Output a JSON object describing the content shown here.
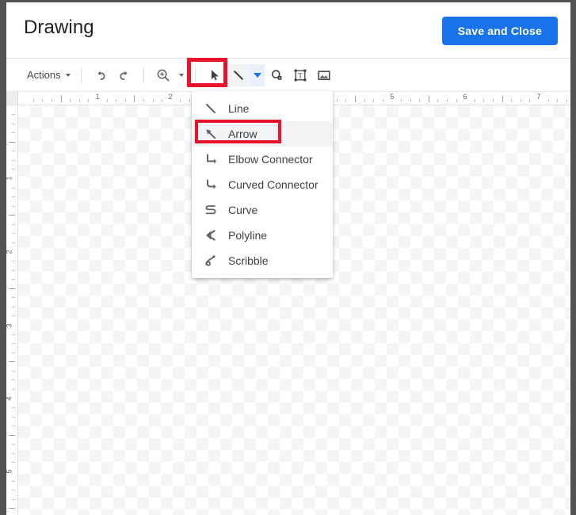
{
  "window": {
    "title": "Drawing"
  },
  "header": {
    "title": "Drawing",
    "save_button_label": "Save and Close",
    "accent_color": "#1a73e8"
  },
  "toolbar": {
    "actions_label": "Actions",
    "items": [
      {
        "name": "actions-menu",
        "label": "Actions"
      },
      {
        "name": "undo-button",
        "label": "Undo"
      },
      {
        "name": "redo-button",
        "label": "Redo"
      },
      {
        "name": "zoom-button",
        "label": "Zoom"
      },
      {
        "name": "select-button",
        "label": "Select"
      },
      {
        "name": "line-button",
        "label": "Line"
      },
      {
        "name": "shape-button",
        "label": "Shape"
      },
      {
        "name": "textbox-button",
        "label": "Text box"
      },
      {
        "name": "image-button",
        "label": "Image"
      }
    ]
  },
  "line_menu": {
    "open": true,
    "selected": "Arrow",
    "items": [
      {
        "label": "Line",
        "icon": "line-icon"
      },
      {
        "label": "Arrow",
        "icon": "arrow-icon"
      },
      {
        "label": "Elbow Connector",
        "icon": "elbow-connector-icon"
      },
      {
        "label": "Curved Connector",
        "icon": "curved-connector-icon"
      },
      {
        "label": "Curve",
        "icon": "curve-icon"
      },
      {
        "label": "Polyline",
        "icon": "polyline-icon"
      },
      {
        "label": "Scribble",
        "icon": "scribble-icon"
      }
    ]
  },
  "annotations": {
    "highlight_color": "#e8132a",
    "boxes": [
      {
        "name": "line-tool-highlight",
        "target": "line-button"
      },
      {
        "name": "arrow-item-highlight",
        "target": "Arrow"
      }
    ]
  },
  "rulers": {
    "horizontal": {
      "unit": "inch",
      "labels": [
        "1",
        "2",
        "3",
        "4",
        "5",
        "6",
        "7"
      ],
      "positions": [
        115,
        207,
        300,
        394,
        487,
        579,
        672
      ]
    },
    "vertical": {
      "unit": "inch",
      "labels": [
        "1",
        "2",
        "3",
        "4",
        "5"
      ],
      "positions": [
        222,
        315,
        408,
        500,
        592
      ]
    }
  },
  "canvas": {
    "background": "transparent-checkerboard"
  }
}
